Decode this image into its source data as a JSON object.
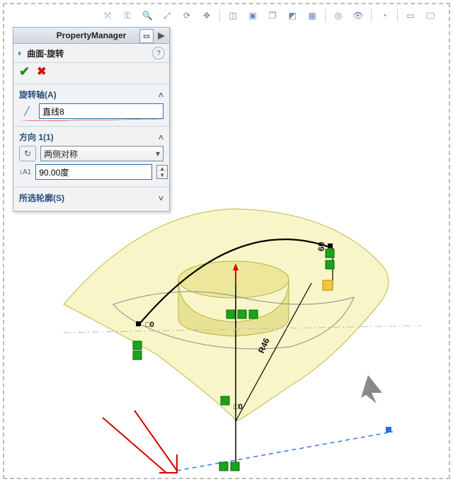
{
  "toolbar": {
    "icons": [
      "axis",
      "key",
      "zoom-fit",
      "zoom",
      "orbit",
      "pan",
      "sep",
      "section",
      "display-style",
      "view-cube",
      "projected",
      "view-settings",
      "sep",
      "look-at",
      "visibility",
      "sep",
      "appearance",
      "sep",
      "camera",
      "screen"
    ]
  },
  "pm": {
    "title": "PropertyManager",
    "feature_label": "曲面-旋转",
    "ok_tip": "OK",
    "cancel_tip": "Cancel",
    "help_tip": "?",
    "sections": {
      "axis": {
        "title": "旋转轴(A)",
        "value": "直线8"
      },
      "dir": {
        "title": "方向 1(1)",
        "option": "两侧对称",
        "angle": "90.00度"
      },
      "profile": {
        "title": "所选轮廓(S)"
      }
    }
  },
  "scene_annotations": {
    "radius_label": "R46",
    "height_label": "60",
    "relation_box": "□0"
  }
}
